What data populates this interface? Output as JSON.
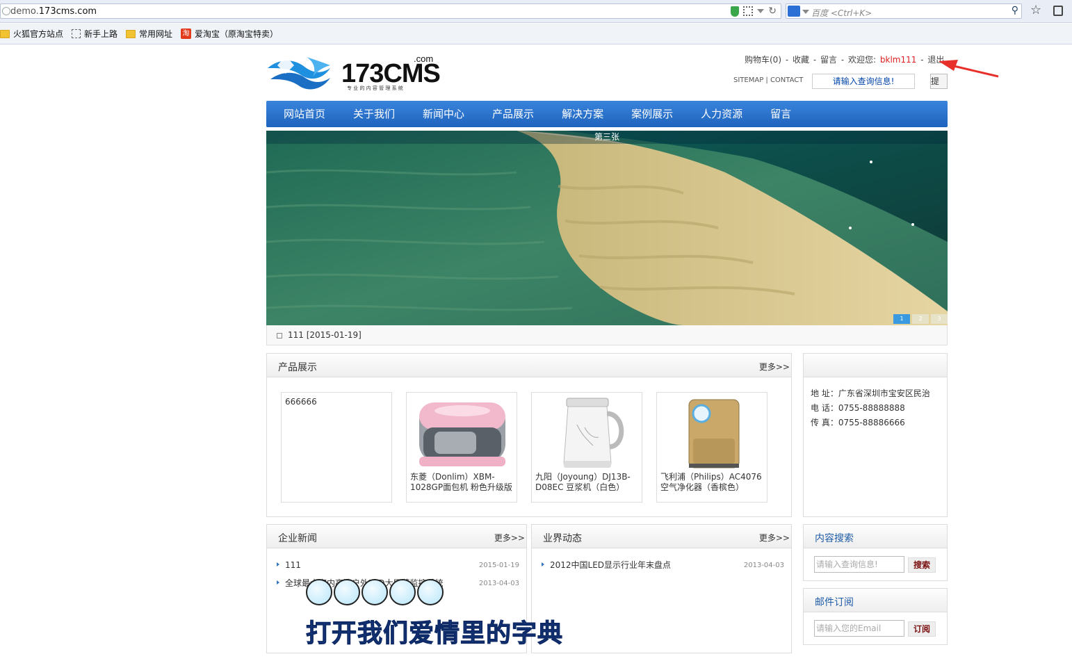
{
  "browser": {
    "url_prefix": "demo.",
    "url_domain": "173cms.com",
    "search_placeholder": "百度 <Ctrl+K>",
    "bookmarks": [
      "火狐官方站点",
      "新手上路",
      "常用网址",
      "爱淘宝（原淘宝特卖）"
    ],
    "taobao_glyph": "淘"
  },
  "header": {
    "logo_text": "173CMS",
    "logo_com": ".com",
    "logo_slogan": "专 业 的 内 容 管 理 系 统",
    "cart": "购物车(0)",
    "sep": "-",
    "favorite": "收藏",
    "message": "留言",
    "welcome": "欢迎您:",
    "username": "bklm111",
    "logout": "退出",
    "sitemap": "SITEMAP | CONTACT",
    "search_placeholder": "请输入查询信息!",
    "submit": "提交"
  },
  "nav": [
    "网站首页",
    "关于我们",
    "新闻中心",
    "产品展示",
    "解决方案",
    "案例展示",
    "人力资源",
    "留言"
  ],
  "banner": {
    "caption": "第三张",
    "dots": [
      "1",
      "2",
      "3"
    ],
    "active_dot": 0
  },
  "notice": "111 [2015-01-19]",
  "products": {
    "title": "产品展示",
    "more": "更多>>",
    "items": [
      {
        "name": "666666",
        "image": "none"
      },
      {
        "name": "东菱（Donlim）XBM-1028GP面包机 粉色升级版",
        "image": "bread-maker"
      },
      {
        "name": "九阳（Joyoung）DJ13B-D08EC 豆浆机（白色）",
        "image": "soymilk-maker"
      },
      {
        "name": "飞利浦（Philips）AC4076 空气净化器（香槟色）",
        "image": "air-purifier"
      }
    ]
  },
  "contact": {
    "address": "地 址：广东省深圳市宝安区民治",
    "phone": "电 话：0755-88888888",
    "fax": "传 真：0755-88886666"
  },
  "company_news": {
    "title": "企业新闻",
    "more": "更多>>",
    "items": [
      {
        "title": "111",
        "date": "2015-01-19"
      },
      {
        "title": "全球最大室内高清户外LED大屏幕监控系统",
        "date": "2013-04-03"
      }
    ]
  },
  "industry_news": {
    "title": "业界动态",
    "more": "更多>>",
    "items": [
      {
        "title": "2012中国LED显示行业年末盘点",
        "date": "2013-04-03"
      }
    ]
  },
  "content_search": {
    "title": "内容搜索",
    "placeholder": "请输入查询信息!",
    "button": "搜索"
  },
  "mail_subscribe": {
    "title": "邮件订阅",
    "placeholder": "请输入您的Email",
    "button": "订阅"
  },
  "overlay_text": "打开我们爱情里的字典",
  "colors": {
    "nav_blue": "#2a72cf",
    "username_red": "#e02020",
    "arrow_red": "#e8302a",
    "overlay_blue": "#1f3f86"
  }
}
